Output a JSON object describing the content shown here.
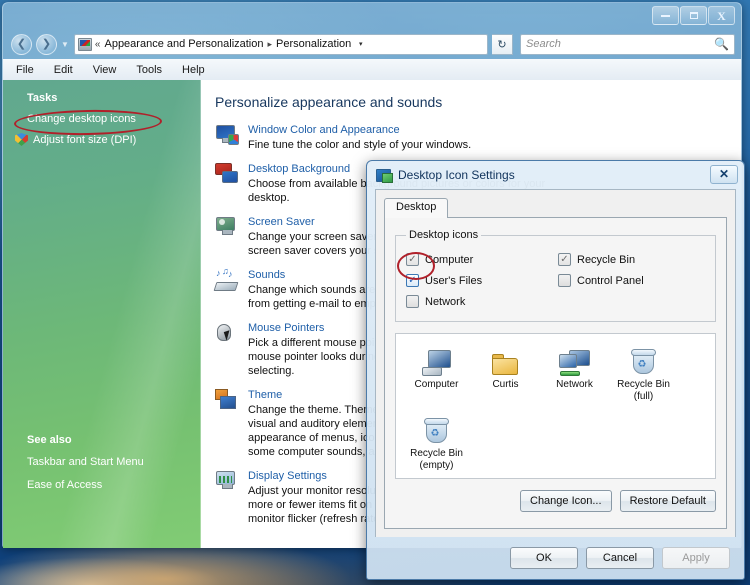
{
  "window": {
    "controls": {
      "minimize": "minimize-button",
      "maximize": "maximize-button",
      "close": "close-button"
    },
    "address": {
      "root_chevrons": "«",
      "crumb1": "Appearance and Personalization",
      "separator": "▸",
      "crumb2": "Personalization",
      "dropdown": "▾",
      "refresh": "↻"
    },
    "search": {
      "placeholder": "Search",
      "value": "",
      "icon": "🔍"
    },
    "menubar": [
      "File",
      "Edit",
      "View",
      "Tools",
      "Help"
    ]
  },
  "sidebar": {
    "tasks_header": "Tasks",
    "tasks": [
      {
        "label": "Change desktop icons",
        "icon": null
      },
      {
        "label": "Adjust font size (DPI)",
        "icon": "shield-icon"
      }
    ],
    "see_also_header": "See also",
    "see_also": [
      {
        "label": "Taskbar and Start Menu"
      },
      {
        "label": "Ease of Access"
      }
    ]
  },
  "main": {
    "title": "Personalize appearance and sounds",
    "items": [
      {
        "title": "Window Color and Appearance",
        "desc": "Fine tune the color and style of your windows."
      },
      {
        "title": "Desktop Background",
        "desc": "Choose from available background pictures or colors for your desktop."
      },
      {
        "title": "Screen Saver",
        "desc": "Change your screen saver or adjust when it appears. A screen saver covers your screen and appears."
      },
      {
        "title": "Sounds",
        "desc": "Change which sounds are heard when you do everything from getting e-mail to emptying your Recycle Bin."
      },
      {
        "title": "Mouse Pointers",
        "desc": "Pick a different mouse pointer. You can also change how the mouse pointer looks during such activities as clicking and selecting."
      },
      {
        "title": "Theme",
        "desc": "Change the theme. Themes can change a wide range of visual and auditory elements at one time, including the appearance of menus, icons, backgrounds, screen savers, some computer sounds, and mouse pointers."
      },
      {
        "title": "Display Settings",
        "desc": "Adjust your monitor resolution, which changes the view so more or fewer items fit on the screen. You can also control monitor flicker (refresh rate)."
      }
    ]
  },
  "dialog": {
    "title": "Desktop Icon Settings",
    "close_glyph": "✕",
    "tab": "Desktop",
    "group_legend": "Desktop icons",
    "checkboxes": [
      {
        "label": "Computer",
        "checked": true,
        "style": "gray"
      },
      {
        "label": "Recycle Bin",
        "checked": true,
        "style": "gray"
      },
      {
        "label": "User's Files",
        "checked": true,
        "style": "blue"
      },
      {
        "label": "Control Panel",
        "checked": false,
        "style": "empty"
      },
      {
        "label": "Network",
        "checked": false,
        "style": "empty"
      }
    ],
    "check_glyph": "✓",
    "preview_icons": [
      {
        "name": "Computer",
        "sub": "",
        "art": "computer-icon"
      },
      {
        "name": "Curtis",
        "sub": "",
        "art": "folder-icon"
      },
      {
        "name": "Network",
        "sub": "",
        "art": "network-icon"
      },
      {
        "name": "Recycle Bin",
        "sub": "(full)",
        "art": "recycle-bin-full-icon"
      },
      {
        "name": "Recycle Bin",
        "sub": "(empty)",
        "art": "recycle-bin-empty-icon"
      }
    ],
    "icon_buttons": [
      {
        "label": "Change Icon...",
        "enabled": true
      },
      {
        "label": "Restore Default",
        "enabled": true
      }
    ],
    "footer_buttons": [
      {
        "label": "OK",
        "enabled": true
      },
      {
        "label": "Cancel",
        "enabled": true
      },
      {
        "label": "Apply",
        "enabled": false
      }
    ]
  },
  "annotations": {
    "accent_color": "#b0202a",
    "ellipses": [
      "change-desktop-icons-highlight",
      "users-files-checkbox-highlight"
    ]
  }
}
